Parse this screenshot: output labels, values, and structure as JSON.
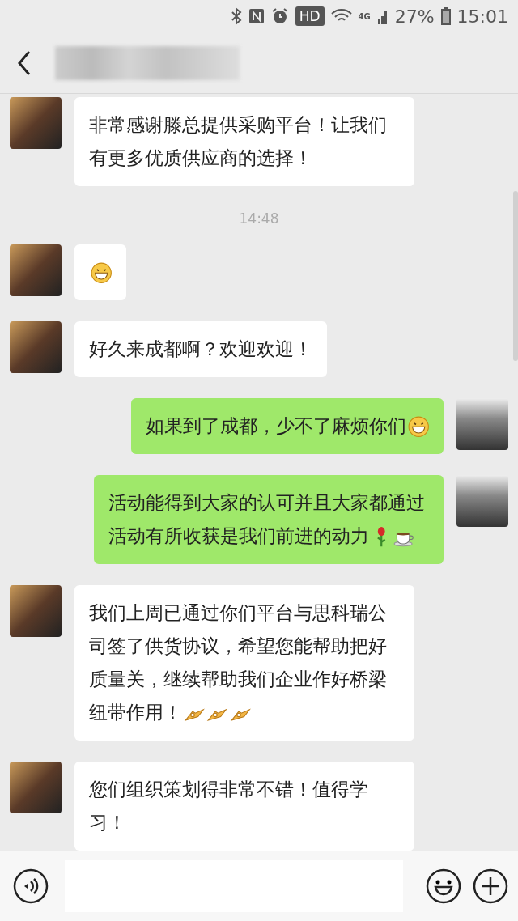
{
  "status_bar": {
    "battery": "27%",
    "time": "15:01",
    "network": "4G",
    "hd": "HD"
  },
  "messages": [
    {
      "kind": "message",
      "outgoing": false,
      "text": "非常感谢滕总提供采购平台！让我们有更多优质供应商的选择！"
    },
    {
      "kind": "time",
      "text": "14:48"
    },
    {
      "kind": "message",
      "outgoing": false,
      "icons": [
        {
          "kind": "grin"
        }
      ]
    },
    {
      "kind": "message",
      "outgoing": false,
      "text": "好久来成都啊？欢迎欢迎！"
    },
    {
      "kind": "message",
      "outgoing": true,
      "text": "如果到了成都，少不了麻烦你们",
      "icons": [
        {
          "kind": "grin"
        }
      ]
    },
    {
      "kind": "message",
      "outgoing": true,
      "text": "活动能得到大家的认可并且大家都通过活动有所收获是我们前进的动力",
      "icons": [
        {
          "kind": "rose"
        },
        {
          "kind": "coffee"
        }
      ]
    },
    {
      "kind": "message",
      "outgoing": false,
      "text": "我们上周已通过你们平台与思科瑞公司签了供货协议，希望您能帮助把好质量关，继续帮助我们企业作好桥梁纽带作用！",
      "icons": [
        {
          "kind": "ok"
        },
        {
          "kind": "ok"
        },
        {
          "kind": "ok"
        }
      ]
    },
    {
      "kind": "message",
      "outgoing": false,
      "text": "您们组织策划得非常不错！值得学习！"
    }
  ]
}
